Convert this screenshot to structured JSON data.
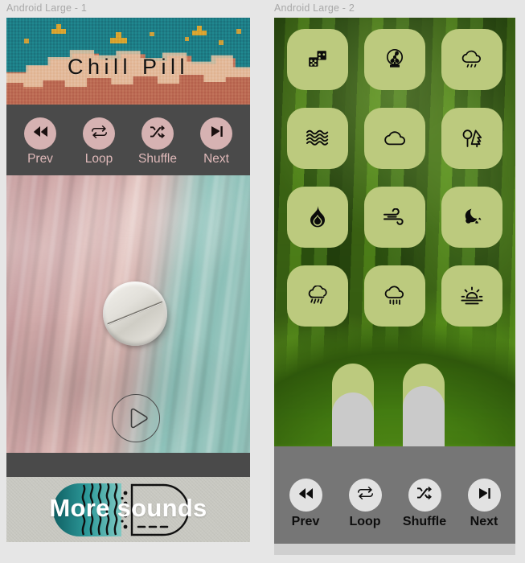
{
  "frames": [
    {
      "label": "Android Large - 1"
    },
    {
      "label": "Android Large - 2"
    }
  ],
  "phone1": {
    "hero": {
      "title": "Chill Pill"
    },
    "transport": {
      "buttons": [
        {
          "icon": "rewind-icon",
          "label": "Prev"
        },
        {
          "icon": "loop-icon",
          "label": "Loop"
        },
        {
          "icon": "shuffle-icon",
          "label": "Shuffle"
        },
        {
          "icon": "next-icon",
          "label": "Next"
        }
      ]
    },
    "artwork": {
      "pill_name": "pill-tablet-graphic",
      "play_button_label": "Play"
    },
    "footer": {
      "text": "More sounds"
    },
    "colors": {
      "sky": "#1d7d86",
      "rock": "#bb6a53",
      "rock_light": "#e8c4a4",
      "sparkle": "#d9a430",
      "bar": "#4a4a4a",
      "button_fill": "#d6b2b2",
      "button_label": "#dfb9b9",
      "footer_bg": "#c9c9c2",
      "footer_text": "#ffffff",
      "capsule_teal": "#1f7d7f"
    }
  },
  "phone2": {
    "grid": [
      {
        "icon": "dice-icon",
        "label": "Dice"
      },
      {
        "icon": "fan-icon",
        "label": "Fan"
      },
      {
        "icon": "rain-cloud-icon",
        "label": "Rain cloud"
      },
      {
        "icon": "waves-icon",
        "label": "Waves"
      },
      {
        "icon": "cloud-icon",
        "label": "Cloud"
      },
      {
        "icon": "trees-icon",
        "label": "Trees"
      },
      {
        "icon": "fire-icon",
        "label": "Fire"
      },
      {
        "icon": "wind-icon",
        "label": "Wind"
      },
      {
        "icon": "night-moon-icon",
        "label": "Night"
      },
      {
        "icon": "drizzle-icon",
        "label": "Drizzle"
      },
      {
        "icon": "heavy-rain-icon",
        "label": "Heavy rain"
      },
      {
        "icon": "sunset-icon",
        "label": "Sunset"
      }
    ],
    "sliders": [
      {
        "name": "volume-slider-1",
        "fill_percent": 72
      },
      {
        "name": "volume-slider-2",
        "fill_percent": 78
      }
    ],
    "transport": {
      "buttons": [
        {
          "icon": "rewind-icon",
          "label": "Prev"
        },
        {
          "icon": "loop-icon",
          "label": "Loop"
        },
        {
          "icon": "shuffle-icon",
          "label": "Shuffle"
        },
        {
          "icon": "next-icon",
          "label": "Next"
        }
      ]
    },
    "colors": {
      "tile": "#bcca7e",
      "bar": "#767676",
      "button_fill": "#e2e2e2",
      "button_label": "#0d0d0d",
      "slider_track": "#bcca7e",
      "slider_fill": "#cacaca"
    }
  },
  "page": {
    "background": "#e6e6e6",
    "label_color": "#a8a8a8"
  }
}
